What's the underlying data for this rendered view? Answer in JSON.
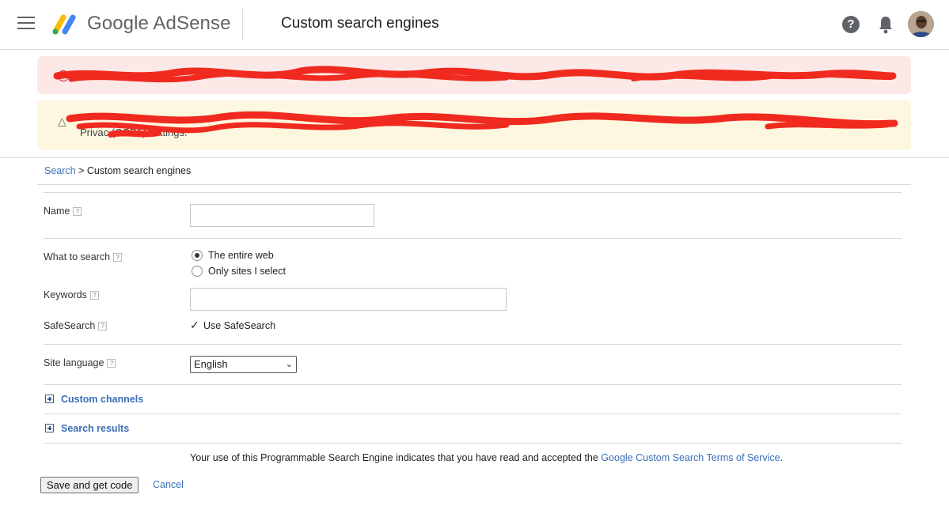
{
  "header": {
    "brand": "Google AdSense",
    "page_title": "Custom search engines",
    "help_glyph": "?"
  },
  "breadcrumb": {
    "root": "Search",
    "separator": ">",
    "current": "Custom search engines"
  },
  "form": {
    "name": {
      "label": "Name",
      "value": ""
    },
    "what_to_search": {
      "label": "What to search",
      "options": [
        "The entire web",
        "Only sites I select"
      ],
      "selected": "The entire web"
    },
    "keywords": {
      "label": "Keywords",
      "value": ""
    },
    "safesearch": {
      "label": "SafeSearch",
      "checkbox_label": "Use SafeSearch",
      "checked": true
    },
    "site_language": {
      "label": "Site language",
      "selected": "English"
    },
    "help_glyph": "?"
  },
  "sections": {
    "custom_channels": "Custom channels",
    "search_results": "Search results"
  },
  "tos": {
    "prefix": "Your use of this Programmable Search Engine indicates that you have read and accepted the",
    "link": "Google Custom Search Terms of Service",
    "suffix": "."
  },
  "actions": {
    "save": "Save and get code",
    "cancel": "Cancel"
  },
  "banners": {
    "warning_fragment": "Privac    (CCPA) settings."
  },
  "colors": {
    "link": "#3a6fb5",
    "error_banner": "#fce8e6",
    "warning_banner": "#fef7e0",
    "redaction": "#f02a1f"
  }
}
